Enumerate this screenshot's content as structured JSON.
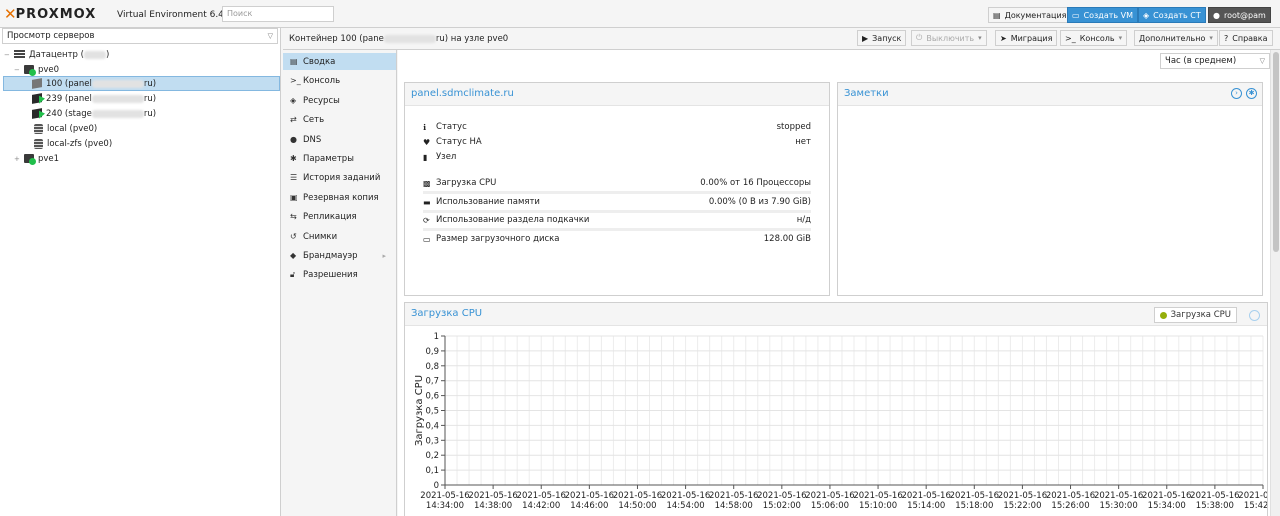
{
  "header": {
    "logo_text": "PROXMOX",
    "version": "Virtual Environment 6.4-4",
    "search_placeholder": "Поиск",
    "docs_label": "Документация",
    "create_vm_label": "Создать VM",
    "create_ct_label": "Создать CT",
    "user_label": "root@pam"
  },
  "tree": {
    "view_label": "Просмотр серверов",
    "datacenter_label": "Датацентр (",
    "node_pve0": "pve0",
    "ct100_prefix": "100 (panel",
    "ct239_prefix": "239 (panel",
    "ct240_prefix": "240 (stage",
    "ct_suffix": "ru)",
    "storage_local": "local (pve0)",
    "storage_zfs": "local-zfs (pve0)",
    "node_pve1": "pve1"
  },
  "content_header": {
    "title_prefix": "Контейнер 100 (pane",
    "title_suffix": "ru) на узле pve0",
    "start_label": "Запуск",
    "shutdown_label": "Выключить",
    "migrate_label": "Миграция",
    "console_label": "Консоль",
    "more_label": "Дополнительно",
    "help_label": "Справка"
  },
  "nav": {
    "items": [
      {
        "label": "Сводка",
        "icon": "book-icon"
      },
      {
        "label": "Консоль",
        "icon": "terminal-icon"
      },
      {
        "label": "Ресурсы",
        "icon": "cube-icon"
      },
      {
        "label": "Сеть",
        "icon": "exchange-icon"
      },
      {
        "label": "DNS",
        "icon": "globe-icon"
      },
      {
        "label": "Параметры",
        "icon": "gear-icon"
      },
      {
        "label": "История заданий",
        "icon": "list-icon"
      },
      {
        "label": "Резервная копия",
        "icon": "floppy-icon"
      },
      {
        "label": "Репликация",
        "icon": "retweet-icon"
      },
      {
        "label": "Снимки",
        "icon": "history-icon"
      },
      {
        "label": "Брандмауэр",
        "icon": "shield-icon"
      },
      {
        "label": "Разрешения",
        "icon": "unlock-icon"
      }
    ]
  },
  "main": {
    "timeframe": "Час (в среднем)",
    "summary_title": "panel.sdmclimate.ru",
    "notes_title": "Заметки",
    "status": {
      "status_label": "Статус",
      "status_value": "stopped",
      "ha_label": "Статус HA",
      "ha_value": "нет",
      "node_label": "Узел",
      "cpu_label": "Загрузка CPU",
      "cpu_value": "0.00% от 16 Процессоры",
      "mem_label": "Использование памяти",
      "mem_value": "0.00% (0 B из 7.90 GiB)",
      "swap_label": "Использование раздела подкачки",
      "swap_value": "н/д",
      "disk_label": "Размер загрузочного диска",
      "disk_value": "128.00 GiB"
    },
    "cpu_panel_title": "Загрузка CPU",
    "cpu_legend": "Загрузка CPU"
  },
  "chart_data": {
    "type": "line",
    "title": "Загрузка CPU",
    "ylabel": "Загрузка CPU",
    "xlabel": "",
    "ylim": [
      0,
      1
    ],
    "yticks": [
      "1",
      "0,9",
      "0,8",
      "0,7",
      "0,6",
      "0,5",
      "0,4",
      "0,3",
      "0,2",
      "0,1",
      "0"
    ],
    "xticks": [
      {
        "date": "2021-05-16",
        "time": "14:34:00"
      },
      {
        "date": "2021-05-16",
        "time": "14:38:00"
      },
      {
        "date": "2021-05-16",
        "time": "14:42:00"
      },
      {
        "date": "2021-05-16",
        "time": "14:46:00"
      },
      {
        "date": "2021-05-16",
        "time": "14:50:00"
      },
      {
        "date": "2021-05-16",
        "time": "14:54:00"
      },
      {
        "date": "2021-05-16",
        "time": "14:58:00"
      },
      {
        "date": "2021-05-16",
        "time": "15:02:00"
      },
      {
        "date": "2021-05-16",
        "time": "15:06:00"
      },
      {
        "date": "2021-05-16",
        "time": "15:10:00"
      },
      {
        "date": "2021-05-16",
        "time": "15:14:00"
      },
      {
        "date": "2021-05-16",
        "time": "15:18:00"
      },
      {
        "date": "2021-05-16",
        "time": "15:22:00"
      },
      {
        "date": "2021-05-16",
        "time": "15:26:00"
      },
      {
        "date": "2021-05-16",
        "time": "15:30:00"
      },
      {
        "date": "2021-05-16",
        "time": "15:34:00"
      },
      {
        "date": "2021-05-16",
        "time": "15:38:00"
      },
      {
        "date": "2021-05-16",
        "time": "15:42:00"
      }
    ],
    "series": [
      {
        "name": "Загрузка CPU",
        "values": []
      }
    ],
    "grid": true,
    "legend": "top-right"
  }
}
